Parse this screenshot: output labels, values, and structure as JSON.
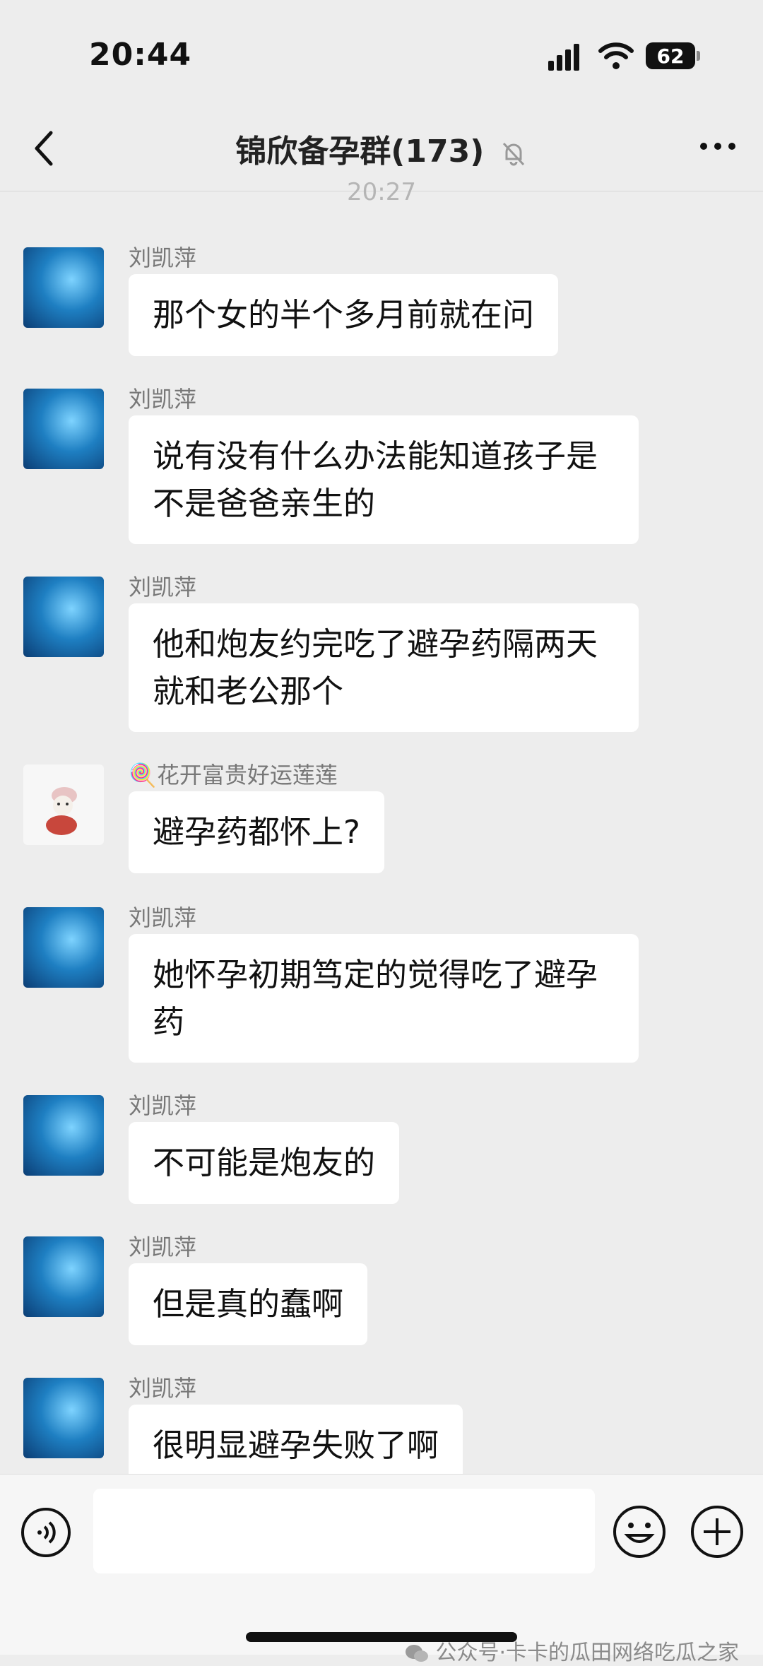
{
  "status_bar": {
    "time": "20:44",
    "battery": "62"
  },
  "header": {
    "title": "锦欣备孕群(173)"
  },
  "timestamp": "20:27",
  "messages": [
    {
      "sender": "刘凯萍",
      "text": "那个女的半个多月前就在问"
    },
    {
      "sender": "刘凯萍",
      "text": "说有没有什么办法能知道孩子是不是爸爸亲生的"
    },
    {
      "sender": "刘凯萍",
      "text": "他和炮友约完吃了避孕药隔两天就和老公那个"
    },
    {
      "sender": "🍭花开富贵好运莲莲",
      "text": "避孕药都怀上?"
    },
    {
      "sender": "刘凯萍",
      "text": "她怀孕初期笃定的觉得吃了避孕药"
    },
    {
      "sender": "刘凯萍",
      "text": "不可能是炮友的"
    },
    {
      "sender": "刘凯萍",
      "text": "但是真的蠢啊"
    },
    {
      "sender": "刘凯萍",
      "text": "很明显避孕失败了啊"
    }
  ],
  "watermark": "公众号·卡卡的瓜田网络吃瓜之家"
}
